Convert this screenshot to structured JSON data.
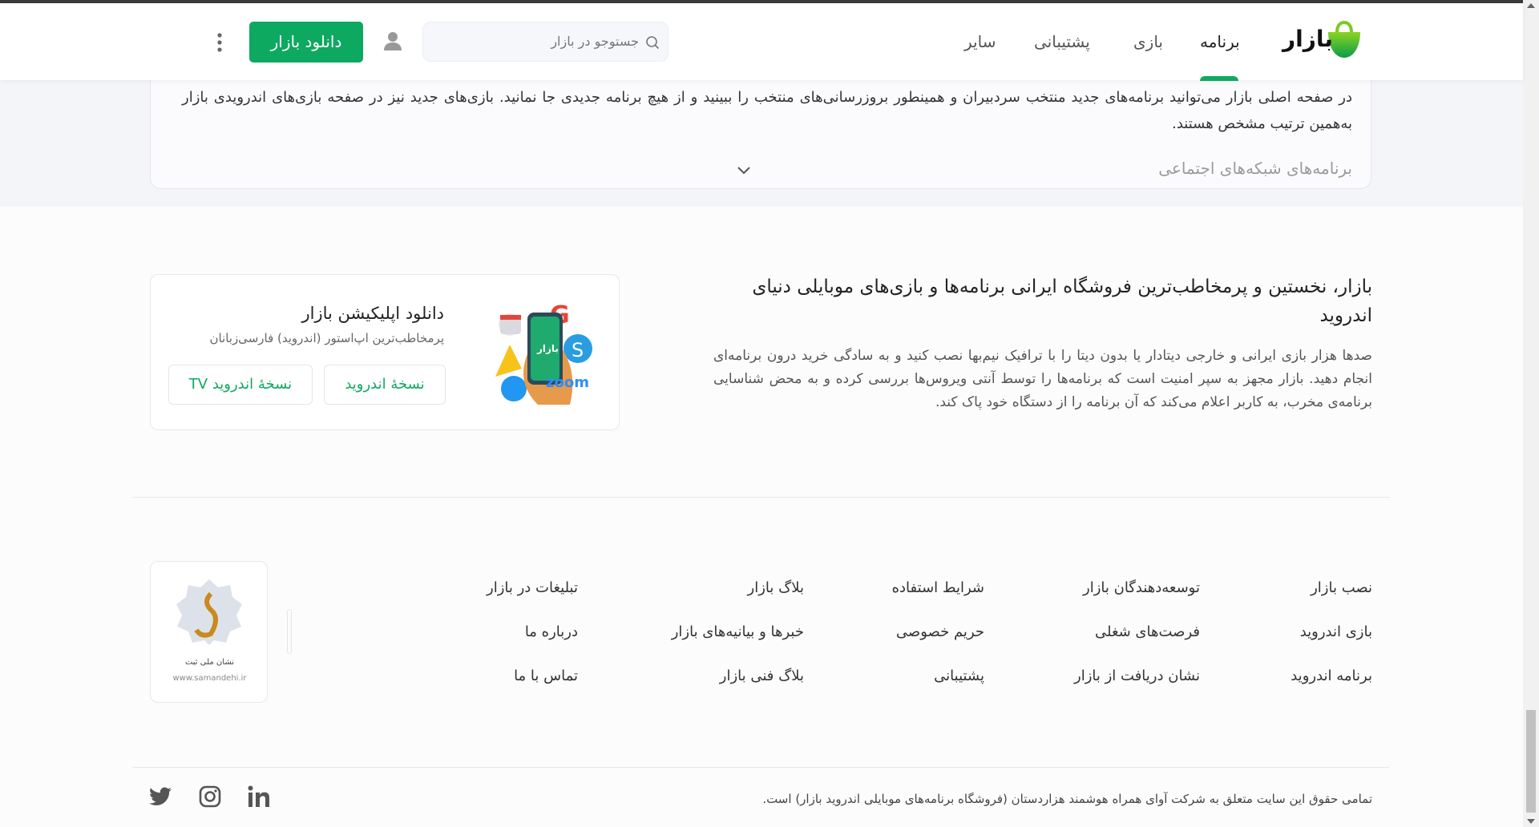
{
  "header": {
    "logo_text": "بازار",
    "nav": [
      {
        "label": "برنامه",
        "active": true
      },
      {
        "label": "بازی"
      },
      {
        "label": "پشتیبانی"
      },
      {
        "label": "سایر"
      }
    ],
    "search_placeholder": "جستوجو در بازار",
    "download_button": "دانلود بازار",
    "accent": "#0ea960"
  },
  "info_card": {
    "paragraph": "در صفحه اصلی بازار می‌توانید برنامه‌های جدید منتخب سردبیران و همینطور بروزرسانی‌های منتخب را ببینید و از هیچ برنامه جدیدی جا نمانید. بازی‌های جدید نیز در صفحه بازی‌های اندرویدی بازار به‌همین ترتیب مشخص هستند.",
    "faded_heading": "برنامه‌های شبکه‌های اجتماعی"
  },
  "about": {
    "title": "بازار، نخستین و پرمخاطب‌ترین فروشگاه ایرانی برنامه‌ها و بازی‌های موبایلی دنیای اندروید",
    "body": "صدها هزار بازی ایرانی و خارجی دیتادار یا بدون دیتا را با ترافیک نیم‌بها نصب کنید و به سادگی خرید درون برنامه‌ای انجام دهید. بازار مجهز به سپر امنیت است که برنامه‌ها را توسط آنتی ویروس‌ها بررسی کرده و به محض شناسایی برنامه‌ی مخرب، به کاربر اعلام می‌کند که آن برنامه را از دستگاه خود پاک کند."
  },
  "app_card": {
    "title": "دانلود اپلیکیشن بازار",
    "subtitle": "پرمخاطب‌ترین اپ‌استور (اندروید) فارسی‌زبانان",
    "android_button": "نسخهٔ اندروید",
    "tv_button": "نسخهٔ اندروید TV",
    "phone_logo": "بازار"
  },
  "footer": {
    "columns": [
      [
        "نصب بازار",
        "بازی اندروید",
        "برنامه اندروید"
      ],
      [
        "توسعه‌دهندگان بازار",
        "فرصت‌های شغلی",
        "نشان دریافت از بازار"
      ],
      [
        "شرایط استفاده",
        "حریم خصوصی",
        "پشتیبانی"
      ],
      [
        "بلاگ بازار",
        "خبرها و بیانیه‌های بازار",
        "بلاگ فنی بازار"
      ],
      [
        "تبلیغات در بازار",
        "درباره ما",
        "تماس با ما"
      ]
    ],
    "seal_title": "نشان ملی ثبت",
    "seal_url": "www.samandehi.ir",
    "copyright": "تمامی حقوق این سایت متعلق به شرکت آوای همراه هوشمند هزاردستان (فروشگاه برنامه‌های موبایلی اندروید بازار) است.",
    "social": [
      "twitter-icon",
      "instagram-icon",
      "linkedin-icon"
    ]
  }
}
